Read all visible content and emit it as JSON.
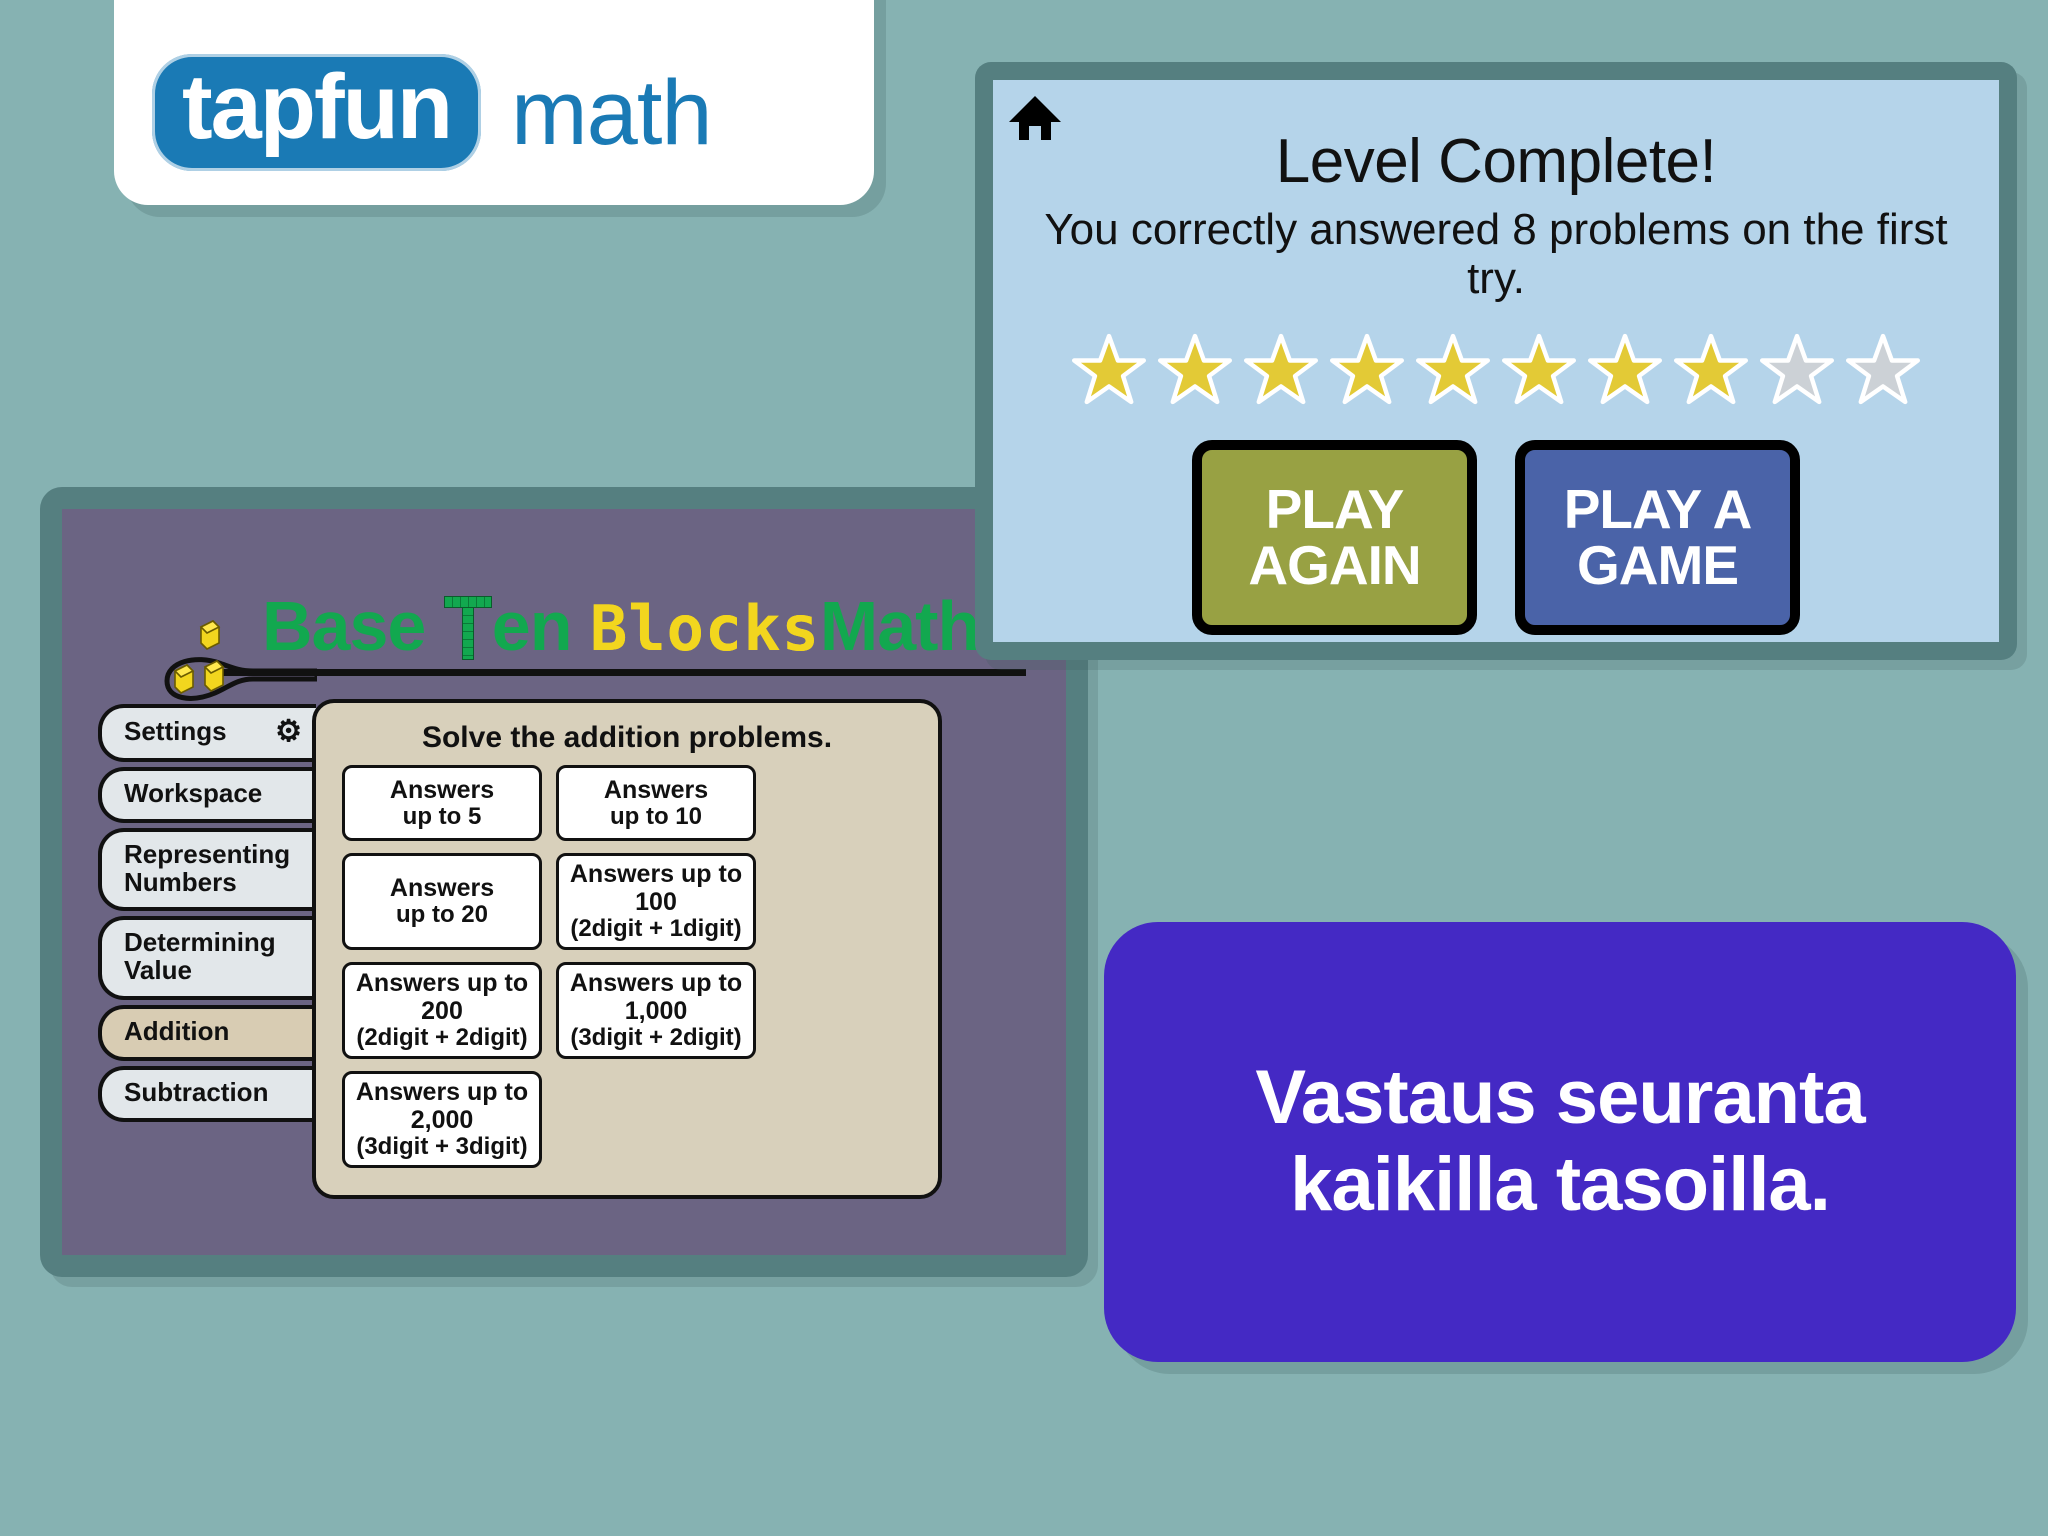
{
  "background_color": "#86b2b2",
  "logo": {
    "brand": "tapfun",
    "product": "math",
    "badge_color": "#1a7ab5",
    "card_color": "#ffffff"
  },
  "base_ten_window": {
    "frame_color": "#557f80",
    "body_color": "#6b6483",
    "title": {
      "part1": "Base ",
      "part2_T": "T",
      "part2_rest": "en ",
      "part3_blocks": "Blocks",
      "part4": "Math",
      "full": "Base Ten Blocks Math",
      "green_color": "#12a84f",
      "yellow_color": "#f2d61e"
    },
    "icon_name": "base-ten-blocks-logo",
    "tabs": [
      {
        "label": "Settings",
        "icon": "gear-icon",
        "active": false
      },
      {
        "label": "Workspace",
        "icon": "",
        "active": false
      },
      {
        "label": "Representing Numbers",
        "icon": "",
        "active": false
      },
      {
        "label": "Determining Value",
        "icon": "",
        "active": false
      },
      {
        "label": "Addition",
        "icon": "",
        "active": true
      },
      {
        "label": "Subtraction",
        "icon": "",
        "active": false
      }
    ],
    "content": {
      "heading": "Solve the addition problems.",
      "panel_color": "#d8d0bb",
      "buttons": [
        {
          "line1": "Answers",
          "line2": "up to 5"
        },
        {
          "line1": "Answers",
          "line2": "up to 10"
        },
        {
          "line1": "Answers",
          "line2": "up to 20"
        },
        {
          "line1": "Answers up to 100",
          "line2": "(2digit + 1digit)"
        },
        {
          "line1": "Answers up to 200",
          "line2": "(2digit + 2digit)"
        },
        {
          "line1": "Answers up to 1,000",
          "line2": "(3digit + 2digit)"
        },
        {
          "line1": "Answers up to 2,000",
          "line2": "(3digit + 3digit)"
        }
      ]
    }
  },
  "level_complete": {
    "frame_color": "#557f80",
    "body_color": "#b5d4ea",
    "home_icon": "home-icon",
    "title": "Level Complete!",
    "subtitle": "You correctly answered 8 problems on the first try.",
    "stars": {
      "total": 10,
      "filled": 8,
      "filled_color": "#e3ca36",
      "empty_color": "#ccd1d6"
    },
    "buttons": [
      {
        "line1": "PLAY",
        "line2": "AGAIN",
        "color": "#98a143"
      },
      {
        "line1": "PLAY A",
        "line2": "GAME",
        "color": "#4a63a8"
      }
    ]
  },
  "finnish_panel": {
    "line1": "Vastaus seuranta",
    "line2": "kaikilla tasoilla.",
    "background_color": "#4429c4",
    "text_color": "#ffffff"
  }
}
